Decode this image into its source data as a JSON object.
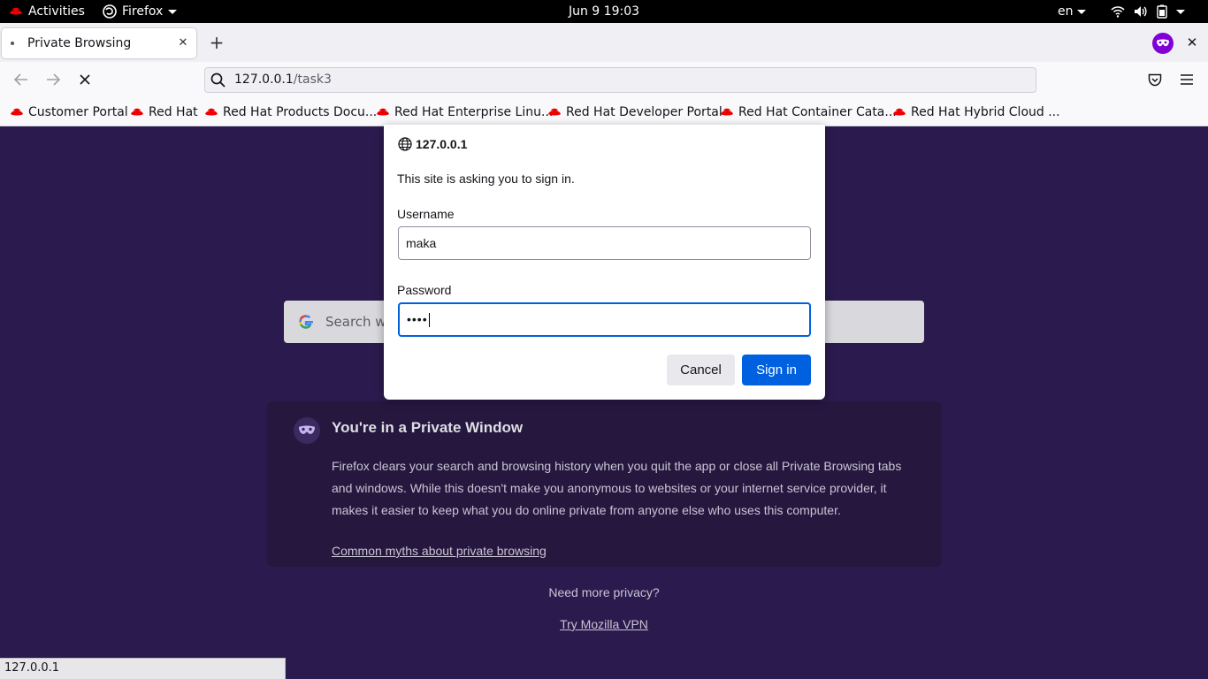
{
  "topbar": {
    "activities": "Activities",
    "app_name": "Firefox",
    "clock": "Jun 9  19:03",
    "language": "en"
  },
  "browser": {
    "tab_title": "Private Browsing",
    "url_host": "127.0.0.1",
    "url_path": "/task3",
    "bookmarks": [
      "Customer Portal",
      "Red Hat",
      "Red Hat Products Docu...",
      "Red Hat Enterprise Linu...",
      "Red Hat Developer Portal",
      "Red Hat Container Cata...",
      "Red Hat Hybrid Cloud ..."
    ],
    "status_text": "127.0.0.1"
  },
  "page": {
    "search_placeholder": "Search wit",
    "private_title": "You're in a Private Window",
    "private_body": "Firefox clears your search and browsing history when you quit the app or close all Private Browsing tabs and windows. While this doesn't make you anonymous to websites or your internet service provider, it makes it easier to keep what you do online private from anyone else who uses this computer.",
    "myths_link": "Common myths about private browsing",
    "more_privacy": "Need more privacy?",
    "vpn_link": "Try Mozilla VPN"
  },
  "dialog": {
    "origin": "127.0.0.1",
    "message": "This site is asking you to sign in.",
    "username_label": "Username",
    "username_value": "maka",
    "password_label": "Password",
    "password_masked": "••••",
    "cancel_label": "Cancel",
    "signin_label": "Sign in"
  },
  "colors": {
    "page_background": "#2b1a4e",
    "primary_button": "#0061e0",
    "private_icon": "#8000d7"
  }
}
